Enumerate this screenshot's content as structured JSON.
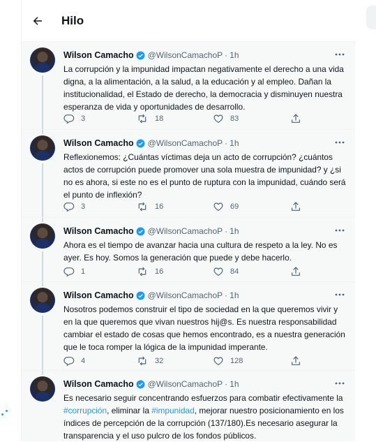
{
  "header": {
    "title": "Hilo"
  },
  "tweets": [
    {
      "name": "Wilson Camacho",
      "handle": "@WilsonCamachoP",
      "sep": "·",
      "time": "1h",
      "text": "La corrupción y la impunidad impactan negativamente el derecho a una vida digna, a la alimentación, a la salud, a la educación y al empleo. Dañan la institucionalidad, el Estado de derecho, la democracia y disminuyen nuestra esperanza de vida y oportunidades de desarrollo.",
      "replies": "3",
      "retweets": "18",
      "likes": "83"
    },
    {
      "name": "Wilson Camacho",
      "handle": "@WilsonCamachoP",
      "sep": "·",
      "time": "1h",
      "text": "Reflexionemos: ¿Cuántas víctimas deja un acto de corrupción? ¿cuántos actos de corrupción puede promover una sola muestra de impunidad? y ¿si no es ahora, si este no es el punto de ruptura con la impunidad, cuándo será el punto de inflexión?",
      "replies": "3",
      "retweets": "16",
      "likes": "69"
    },
    {
      "name": "Wilson Camacho",
      "handle": "@WilsonCamachoP",
      "sep": "·",
      "time": "1h",
      "text": "Ahora es el tiempo de avanzar hacia una cultura de respeto a la ley. No es ayer. Es hoy. Somos la generación que puede y debe hacerlo.",
      "replies": "1",
      "retweets": "16",
      "likes": "84"
    },
    {
      "name": "Wilson Camacho",
      "handle": "@WilsonCamachoP",
      "sep": "·",
      "time": "1h",
      "text": "Nosotros podemos construir el tipo de sociedad en la que queremos vivir y en la que queremos que vivan nuestros hij@s. Es nuestra responsabilidad cambiar el estado de cosas que hemos encontrado, es a nuestra generación que le toca romper la lógica de la impunidad imperante.",
      "replies": "4",
      "retweets": "32",
      "likes": "128"
    },
    {
      "name": "Wilson Camacho",
      "handle": "@WilsonCamachoP",
      "sep": "·",
      "time": "1h",
      "text_before": "Es necesario seguir concentrando esfuerzos para combatir efectivamente la ",
      "hashtag1": "#corrupción",
      "text_middle": ", eliminar la ",
      "hashtag2": "#impunidad",
      "text_after": ", mejorar nuestro posicionamiento en los índices de percepción de la corrupción (137/180).Es necesario asegurar la transparencia y el uso pulcro de los fondos públicos."
    }
  ],
  "icons": {
    "back": "arrow-left-icon",
    "verified": "verified-badge-icon",
    "more": "more-dots-icon",
    "reply": "reply-icon",
    "retweet": "retweet-icon",
    "like": "heart-icon",
    "share": "share-icon"
  },
  "colors": {
    "accent": "#1d9bf0",
    "muted": "#536471",
    "tweet_bg": "#f7f9f9",
    "text": "#0f1419"
  }
}
